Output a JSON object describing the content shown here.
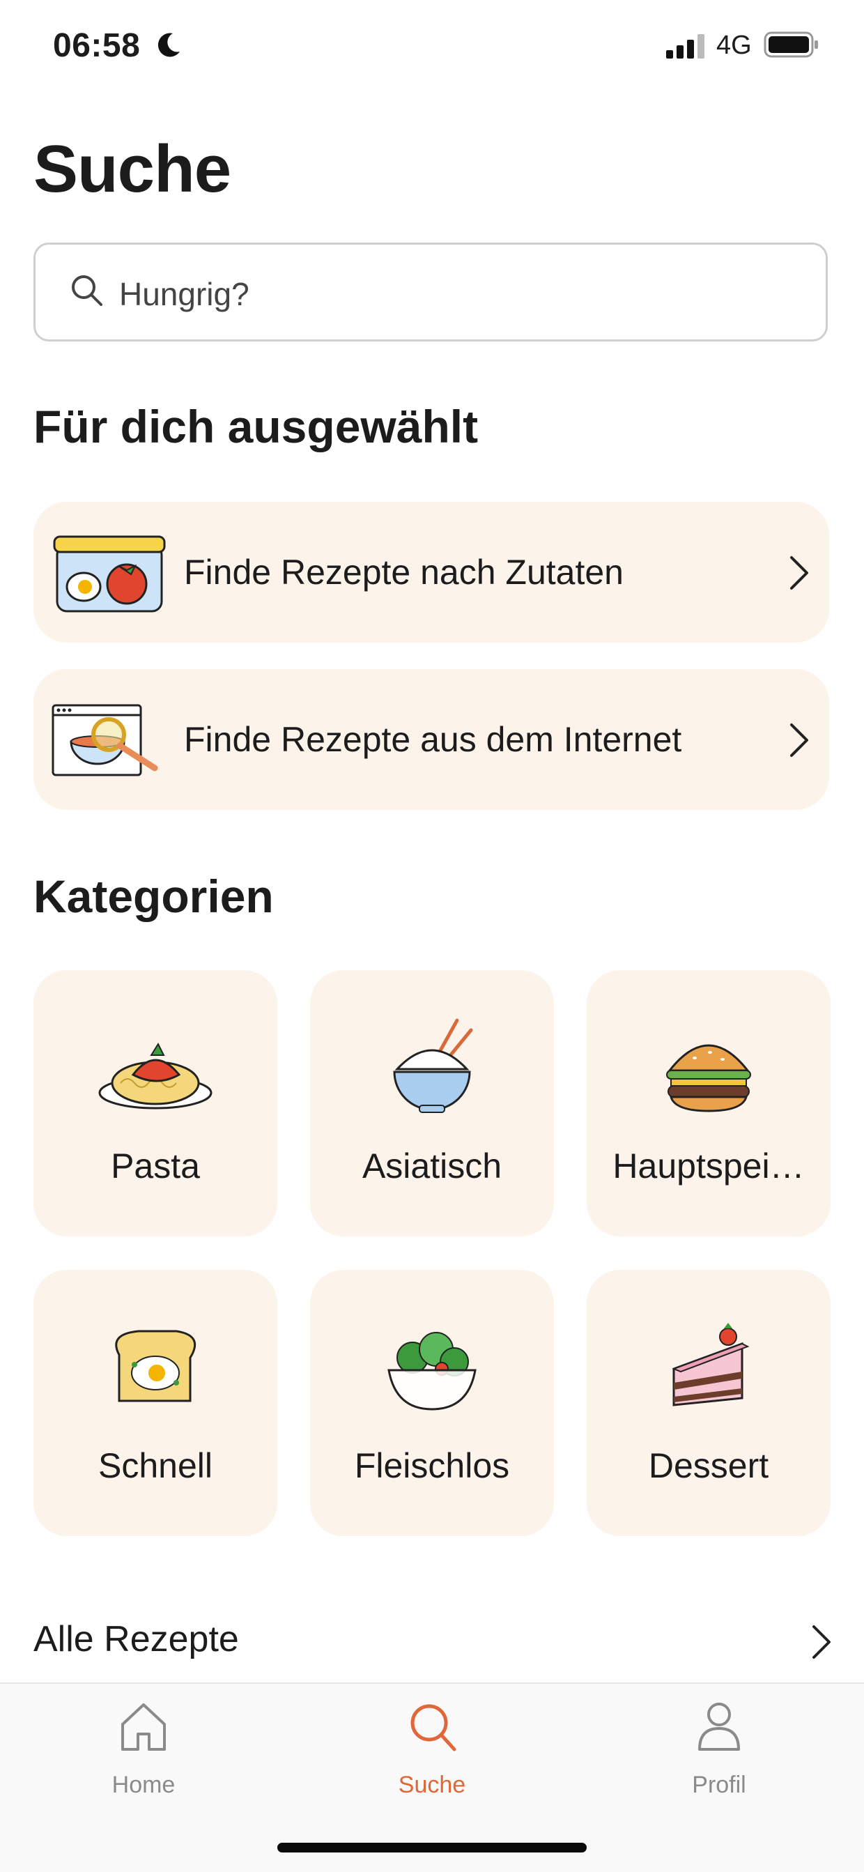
{
  "status_bar": {
    "time": "06:58",
    "network": "4G"
  },
  "header": {
    "title": "Suche"
  },
  "search": {
    "placeholder": "Hungrig?"
  },
  "featured": {
    "title": "Für dich ausgewählt",
    "items": [
      {
        "label": "Finde Rezepte nach Zutaten",
        "icon": "food-container-icon"
      },
      {
        "label": "Finde Rezepte aus dem Internet",
        "icon": "web-search-soup-icon"
      }
    ]
  },
  "categories": {
    "title": "Kategorien",
    "items": [
      {
        "label": "Pasta",
        "icon": "pasta-icon"
      },
      {
        "label": "Asiatisch",
        "icon": "rice-bowl-icon"
      },
      {
        "label": "Hauptspei…",
        "icon": "burger-icon"
      },
      {
        "label": "Schnell",
        "icon": "toast-egg-icon"
      },
      {
        "label": "Fleischlos",
        "icon": "salad-icon"
      },
      {
        "label": "Dessert",
        "icon": "cake-icon"
      }
    ]
  },
  "all_recipes": {
    "label": "Alle Rezepte"
  },
  "tab_bar": {
    "items": [
      {
        "label": "Home",
        "icon": "home-icon",
        "active": false
      },
      {
        "label": "Suche",
        "icon": "search-icon",
        "active": true
      },
      {
        "label": "Profil",
        "icon": "profile-icon",
        "active": false
      }
    ]
  },
  "colors": {
    "accent": "#e0673a",
    "card_background": "#fcf3ea",
    "text": "#1c1c1c",
    "tab_inactive": "#8a8a8a"
  }
}
